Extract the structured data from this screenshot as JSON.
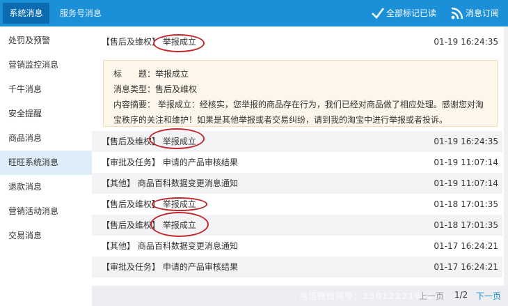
{
  "header": {
    "tabs": [
      "系统消息",
      "服务号消息"
    ],
    "mark_all_read": "全部标记已读",
    "subscribe": "消息订阅"
  },
  "sidebar": {
    "items": [
      "处罚及预警",
      "营销监控消息",
      "千牛消息",
      "安全提醒",
      "商品消息",
      "旺旺系统消息",
      "退款消息",
      "营销活动消息",
      "交易消息"
    ]
  },
  "messages": [
    {
      "category": "【售后及维权】",
      "title": "举报成立",
      "time": "01-19 16:24:35"
    },
    {
      "category": "【售后及维权】",
      "title": "举报成立",
      "time": "01-19 16:24:35"
    },
    {
      "category": "【审批及任务】",
      "title": "申请的产品审核结果",
      "time": "01-19 11:07:14"
    },
    {
      "category": "【其他】",
      "title": "商品百科数据变更消息通知",
      "time": "01-19 11:07:14"
    },
    {
      "category": "【售后及维权】",
      "title": "举报成立",
      "time": "01-18 17:01:35"
    },
    {
      "category": "【售后及维权】",
      "title": "举报成立",
      "time": "01-18 17:01:35"
    },
    {
      "category": "【其他】",
      "title": "商品百科数据变更消息通知",
      "time": "01-17 16:24:21"
    },
    {
      "category": "【审批及任务】",
      "title": "申请的产品审核结果",
      "time": "01-17 16:24:21"
    }
  ],
  "detail": {
    "title_label": "标　　题：",
    "title_value": "举报成立",
    "type_label": "消息类型：",
    "type_value": "售后及维权",
    "content_label": "内容摘要：",
    "content_value": "举报成立：经核实，您举报的商品存在行为，我们已经对商品做了相应处理。感谢您对淘宝秩序的关注和维护！如果是其他举报或者交易纠纷，请到我的淘宝中进行举报或者投诉。"
  },
  "pager": {
    "prev": "上一页",
    "page": "1/2",
    "next": "下一页"
  },
  "watermark": "电话微信同号：15012221616"
}
